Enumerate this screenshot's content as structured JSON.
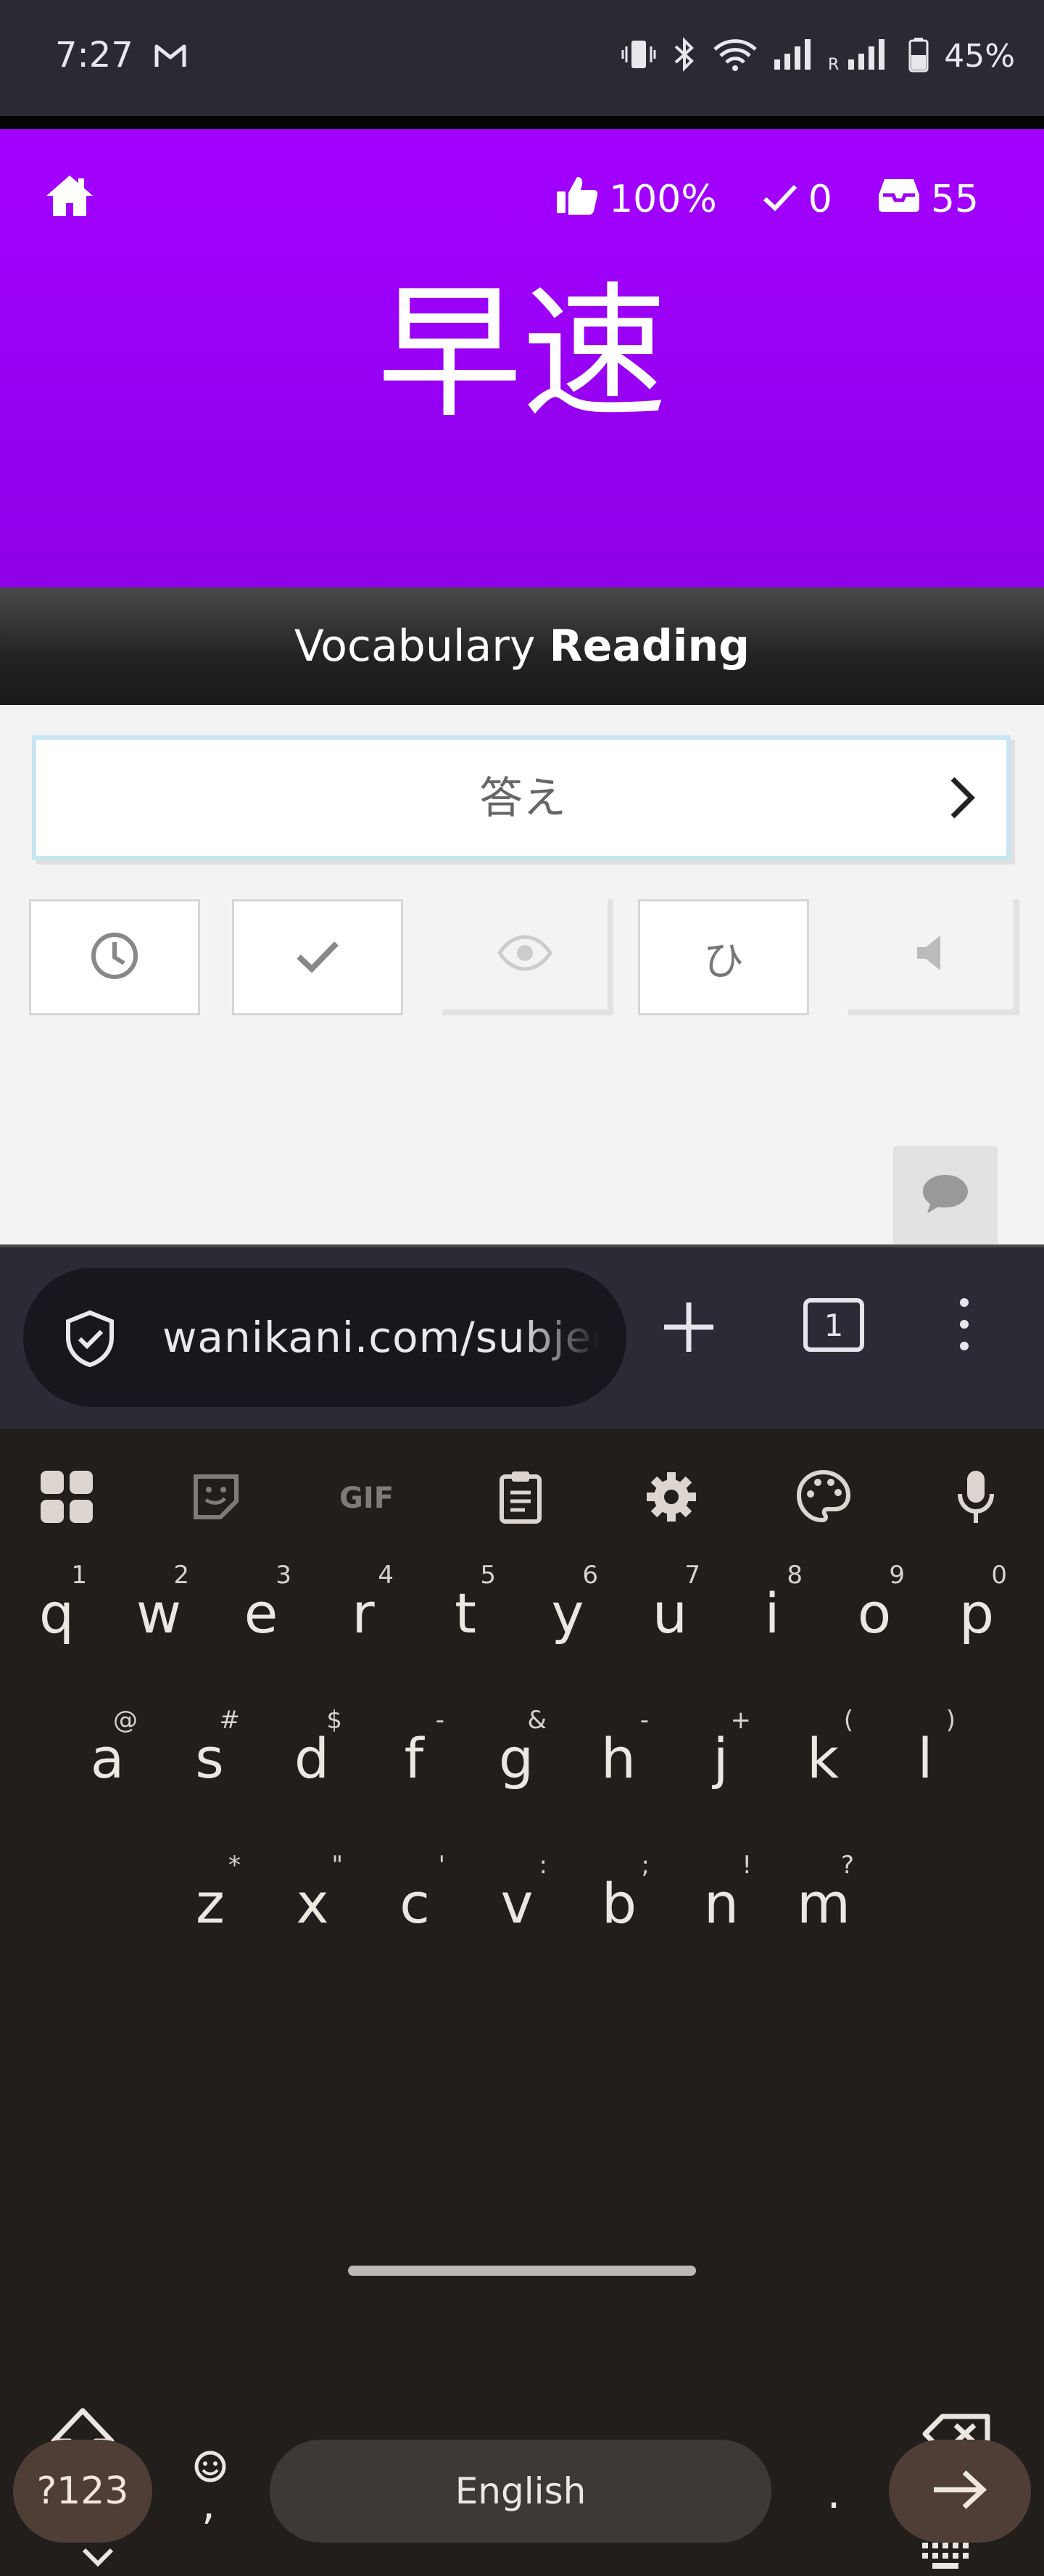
{
  "status_bar": {
    "time": "7:27",
    "battery": "45%"
  },
  "header": {
    "accuracy": "100%",
    "completed": "0",
    "remaining": "55",
    "subject": "早速",
    "background_color": "#a000ff"
  },
  "prompt_bar": {
    "category": "Vocabulary",
    "type": "Reading"
  },
  "answer": {
    "placeholder": "答え",
    "value": ""
  },
  "tools": {
    "kana_label": "ひ"
  },
  "browser": {
    "url": "wanikani.com/subjec",
    "tab_count": "1"
  },
  "keyboard": {
    "rows": [
      {
        "keys": [
          {
            "k": "q",
            "h": "1"
          },
          {
            "k": "w",
            "h": "2"
          },
          {
            "k": "e",
            "h": "3"
          },
          {
            "k": "r",
            "h": "4"
          },
          {
            "k": "t",
            "h": "5"
          },
          {
            "k": "y",
            "h": "6"
          },
          {
            "k": "u",
            "h": "7"
          },
          {
            "k": "i",
            "h": "8"
          },
          {
            "k": "o",
            "h": "9"
          },
          {
            "k": "p",
            "h": "0"
          }
        ]
      },
      {
        "keys": [
          {
            "k": "a",
            "h": "@"
          },
          {
            "k": "s",
            "h": "#"
          },
          {
            "k": "d",
            "h": "$"
          },
          {
            "k": "f",
            "h": "-"
          },
          {
            "k": "g",
            "h": "&"
          },
          {
            "k": "h",
            "h": "-"
          },
          {
            "k": "j",
            "h": "+"
          },
          {
            "k": "k",
            "h": "("
          },
          {
            "k": "l",
            "h": ")"
          }
        ]
      },
      {
        "keys": [
          {
            "k": "z",
            "h": "*"
          },
          {
            "k": "x",
            "h": "\""
          },
          {
            "k": "c",
            "h": "'"
          },
          {
            "k": "v",
            "h": ":"
          },
          {
            "k": "b",
            "h": ";"
          },
          {
            "k": "n",
            "h": "!"
          },
          {
            "k": "m",
            "h": "?"
          }
        ]
      }
    ],
    "symbols_label": "?123",
    "space_label": "English",
    "emoji_hint": ",",
    "period_label": "."
  }
}
